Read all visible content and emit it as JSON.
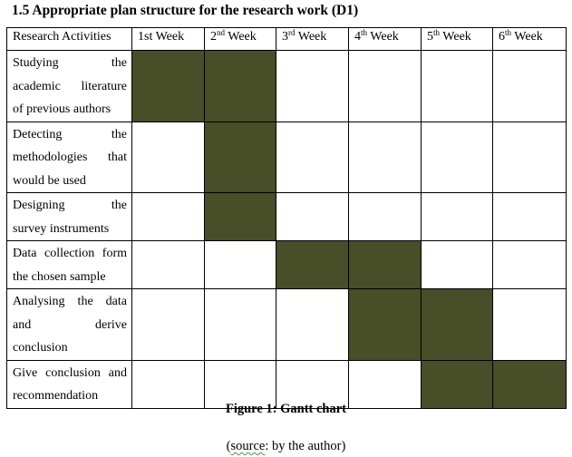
{
  "heading": "1.5 Appropriate plan structure for the research work (D1)",
  "chart_data": {
    "type": "table",
    "subtype": "gantt",
    "title": "Figure 1: Gantt chart",
    "source_prefix": "(",
    "source_word": "source",
    "source_suffix": ":  by the author)",
    "corner_header": "Research Activities",
    "columns": [
      {
        "base": "1st Week",
        "sup": ""
      },
      {
        "base": "2",
        "sup": "nd",
        "rest": " Week"
      },
      {
        "base": "3",
        "sup": "rd",
        "rest": " Week"
      },
      {
        "base": "4",
        "sup": "th",
        "rest": " Week"
      },
      {
        "base": "5",
        "sup": "th",
        "rest": " Week"
      },
      {
        "base": "6",
        "sup": "th",
        "rest": " Week"
      }
    ],
    "fill_color": "#484E28",
    "rows": [
      {
        "activity_lines": [
          "Studying the",
          "academic literature",
          "of previous authors"
        ],
        "weeks": [
          1,
          1,
          0,
          0,
          0,
          0
        ]
      },
      {
        "activity_lines": [
          "Detecting the",
          "methodologies that",
          "would be used"
        ],
        "weeks": [
          0,
          1,
          0,
          0,
          0,
          0
        ]
      },
      {
        "activity_lines": [
          "Designing the",
          "survey instruments"
        ],
        "weeks": [
          0,
          1,
          0,
          0,
          0,
          0
        ]
      },
      {
        "activity_lines": [
          "Data collection form",
          "the chosen sample"
        ],
        "weeks": [
          0,
          0,
          1,
          1,
          0,
          0
        ]
      },
      {
        "activity_lines": [
          "Analysing the data",
          "and derive",
          "conclusion"
        ],
        "weeks": [
          0,
          0,
          0,
          1,
          1,
          0
        ]
      },
      {
        "activity_lines": [
          "Give conclusion and",
          "recommendation"
        ],
        "weeks": [
          0,
          0,
          0,
          0,
          1,
          1
        ]
      }
    ]
  }
}
